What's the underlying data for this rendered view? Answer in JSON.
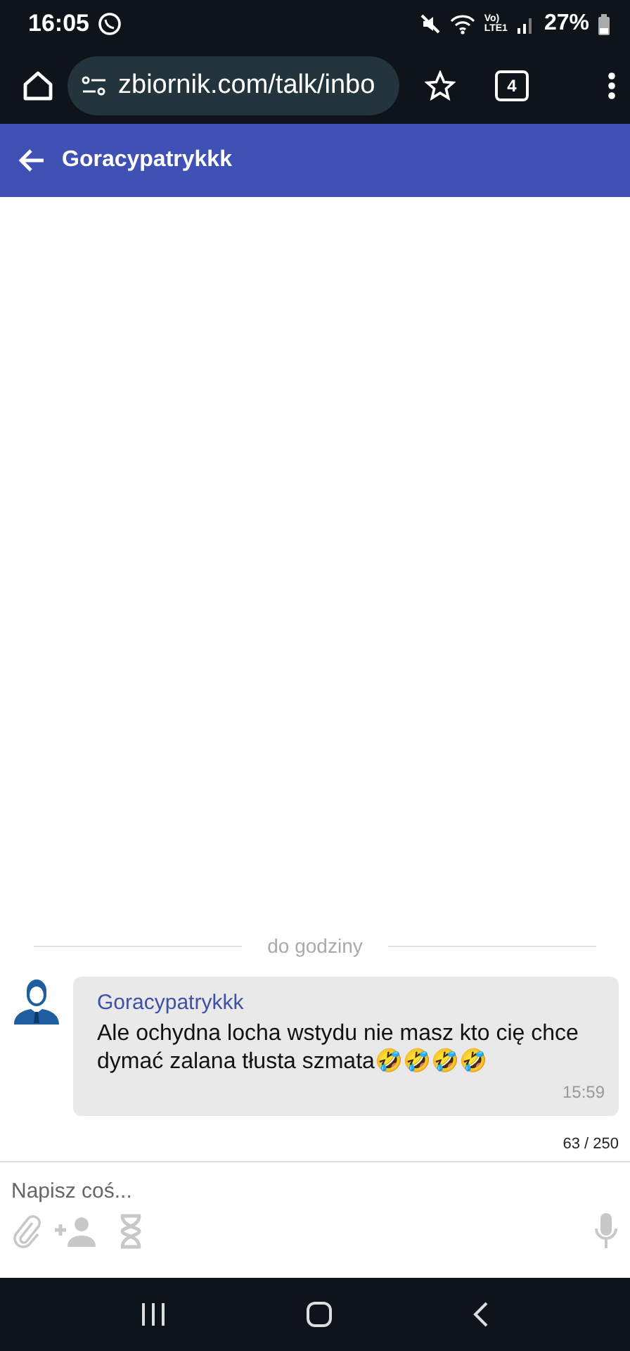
{
  "status_bar": {
    "time": "16:05",
    "network_top": "Vo)",
    "network_bottom": "LTE1",
    "battery": "27%"
  },
  "browser": {
    "url": "zbiornik.com/talk/inbo",
    "tab_count": "4"
  },
  "header": {
    "title": "Goracypatrykkk"
  },
  "divider": "do godziny",
  "messages": [
    {
      "author": "Goracypatrykkk",
      "text": "Ale ochydna locha wstydu nie masz kto cię chce dymać zalana tłusta szmata🤣🤣🤣🤣",
      "time": "15:59"
    }
  ],
  "composer": {
    "counter": "63 / 250",
    "placeholder": "Napisz coś..."
  }
}
